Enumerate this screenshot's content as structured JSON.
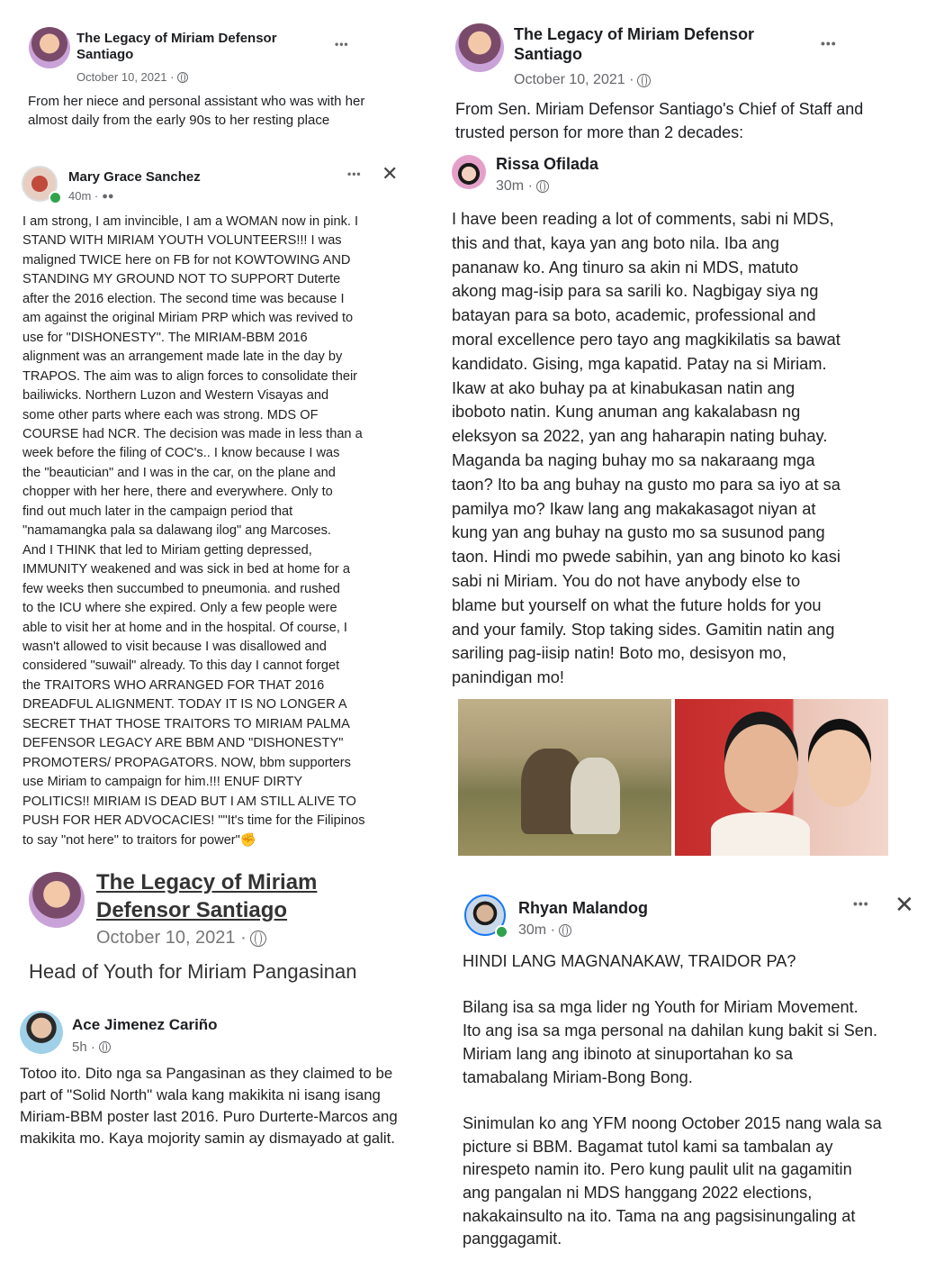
{
  "panel_tl": {
    "page_name": "The Legacy of Miriam Defensor Santiago",
    "date": "October 10, 2021 ·",
    "caption": "From her niece and personal assistant who was with her almost daily from the early 90s to her resting place",
    "dots": "•••",
    "comment": {
      "author": "Mary Grace Sanchez",
      "time": "40m ·",
      "text": "I am strong, I am invincible, I am a WOMAN now in pink. I\nSTAND WITH MIRIAM YOUTH VOLUNTEERS!!! I was\nmaligned TWICE here on FB for not KOWTOWING AND\nSTANDING MY GROUND NOT TO SUPPORT Duterte\nafter the 2016 election. The second time was because I\nam against the original Miriam PRP which was revived to\nuse for \"DISHONESTY\". The MIRIAM-BBM 2016\nalignment was an arrangement made late in the day by\nTRAPOS. The aim was to align forces to consolidate their\nbailiwicks. Northern Luzon and Western Visayas and\nsome other parts where each was strong. MDS OF\nCOURSE had NCR. The decision was made in less than a\nweek before the filing of COC's.. I know because I was\nthe \"beautician\" and I was in the car, on the plane and\nchopper with her here, there and everywhere. Only to\nfind out much later in the campaign period that\n\"namamangka pala sa dalawang ilog\" ang Marcoses.\nAnd I THINK that led to Miriam getting depressed,\nIMMUNITY weakened and was sick in bed at home for a\nfew weeks then succumbed to pneumonia. and rushed\nto the ICU where she expired. Only a few people were\nable to visit her at home and in the hospital. Of course, I\nwasn't allowed to visit because I was disallowed and\nconsidered \"suwail\" already.  To this day I cannot forget\nthe TRAITORS WHO ARRANGED FOR THAT 2016\nDREADFUL ALIGNMENT. TODAY IT IS NO LONGER A\nSECRET THAT THOSE TRAITORS TO MIRIAM PALMA\nDEFENSOR LEGACY ARE BBM AND \"DISHONESTY\"\nPROMOTERS/ PROPAGATORS. NOW, bbm supporters\nuse Miriam to campaign for him.!!! ENUF DIRTY\nPOLITICS!! MIRIAM IS DEAD BUT I AM STILL ALIVE TO\nPUSH FOR HER ADVOCACIES! \"\"It's time for the Filipinos\nto say \"not here\" to traitors for power\"✊"
    }
  },
  "panel_tr": {
    "page_name": "The Legacy of Miriam Defensor Santiago",
    "date": "October 10, 2021 ·",
    "caption": "From Sen. Miriam Defensor Santiago's Chief of Staff and trusted person for more than 2 decades:",
    "dots": "•••",
    "comment": {
      "author": "Rissa Ofilada",
      "time": "30m ·",
      "text": "I have been reading a lot of comments, sabi ni MDS,\nthis and that, kaya yan ang boto nila. Iba ang\npananaw ko. Ang tinuro sa akin ni MDS, matuto\nakong mag-isip para sa sarili ko. Nagbigay siya ng\nbatayan para sa boto, academic, professional and\nmoral excellence pero tayo ang magkikilatis sa bawat\nkandidato. Gising, mga kapatid. Patay na si Miriam.\nIkaw at ako buhay pa at kinabukasan natin ang\niboboto natin. Kung anuman ang kakalabasn ng\neleksyon sa 2022, yan ang haharapin nating buhay.\nMaganda ba naging buhay mo sa nakaraang mga\ntaon? Ito ba ang buhay na gusto mo para sa iyo at sa\npamilya mo? Ikaw lang ang makakasagot niyan at\nkung yan ang buhay na gusto mo sa susunod pang\ntaon.  Hindi mo pwede sabihin, yan ang binoto ko kasi\nsabi ni Miriam. You do not have anybody else to\nblame but yourself on what the future holds for you\nand your family. Stop taking sides. Gamitin natin ang\nsariling pag-iisip natin! Boto mo, desisyon mo,\npanindigan mo!"
    }
  },
  "panel_bl": {
    "page_name": "The Legacy of Miriam Defensor Santiago",
    "date": "October 10, 2021 ·",
    "caption": "Head of Youth for Miriam Pangasinan",
    "comment": {
      "author": "Ace Jimenez Cariño",
      "time": "5h ·",
      "text": "Totoo ito. Dito nga sa Pangasinan as they claimed to be\npart of \"Solid North\" wala kang makikita ni isang isang\nMiriam-BBM poster last 2016. Puro Durterte-Marcos ang\nmakikita mo. Kaya mojority samin ay dismayado at galit."
    }
  },
  "panel_br": {
    "author": "Rhyan Malandog",
    "time": "30m ·",
    "dots": "•••",
    "text": "HINDI LANG MAGNANAKAW, TRAIDOR PA?\n\nBilang isa sa mga lider ng Youth for Miriam Movement.\nIto ang isa sa mga personal na dahilan kung bakit si Sen.\nMiriam lang ang ibinoto at sinuportahan ko sa\ntamabalang Miriam-Bong Bong.\n\nSinimulan ko ang YFM noong October 2015 nang wala sa\npicture si BBM. Bagamat tutol kami sa tambalan ay\nnirespeto namin ito. Pero kung paulit ulit na gagamitin\nang pangalan ni MDS hanggang 2022 elections,\nnakakainsulto  na ito. Tama na ang pagsisinungaling at\npanggagamit."
  },
  "icons": {
    "close": "✕"
  }
}
